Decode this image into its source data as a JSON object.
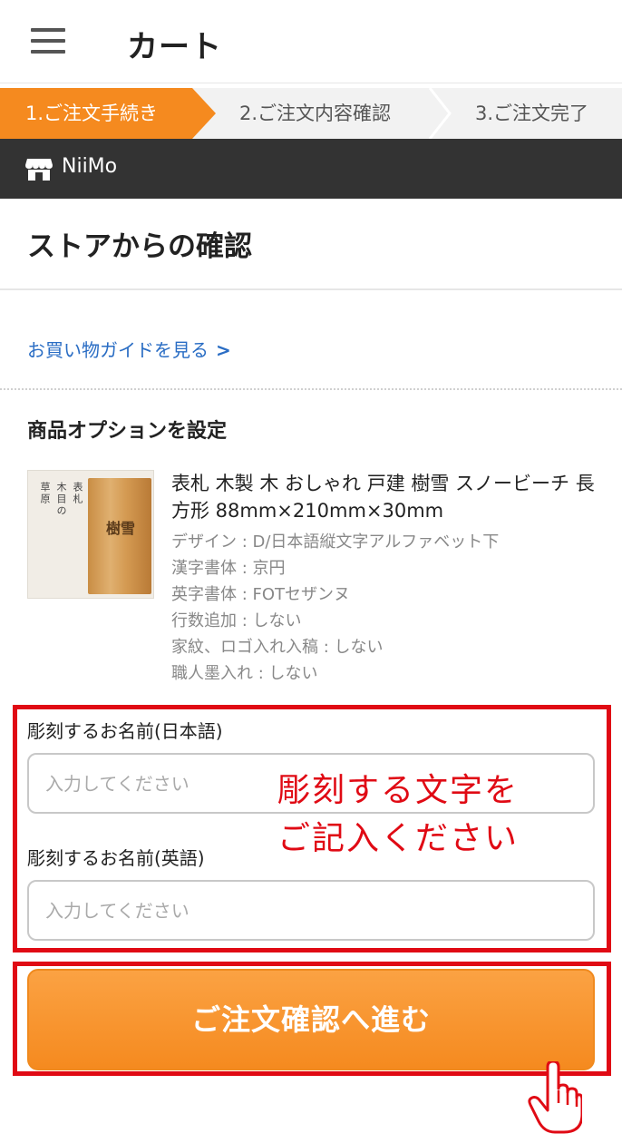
{
  "header": {
    "title": "カート"
  },
  "steps": [
    {
      "label": "1.ご注文手続き",
      "active": true
    },
    {
      "label": "2.ご注文内容確認",
      "active": false
    },
    {
      "label": "3.ご注文完了",
      "active": false
    }
  ],
  "store": {
    "name": "NiiMo",
    "icon": "store-icon"
  },
  "section": {
    "title": "ストアからの確認"
  },
  "guide": {
    "label": "お買い物ガイドを見る",
    "arrow": ">"
  },
  "options": {
    "title": "商品オプションを設定"
  },
  "product": {
    "name": "表札 木製 木 おしゃれ 戸建 樹雪 スノービーチ 長方形 88mm×210mm×30mm",
    "attributes": [
      "デザイン : D/日本語縦文字アルファベット下",
      "漢字書体 : 京円",
      "英字書体 : FOTセザンヌ",
      "行数追加 : しない",
      "家紋、ロゴ入れ入稿 : しない",
      "職人墨入れ : しない"
    ],
    "thumbnail": {
      "plank_text": "樹雪",
      "v1": "草原",
      "v2": "木目の",
      "v3": "表札"
    }
  },
  "form": {
    "name_jp": {
      "label": "彫刻するお名前(日本語)",
      "placeholder": "入力してください",
      "value": ""
    },
    "name_en": {
      "label": "彫刻するお名前(英語)",
      "placeholder": "入力してください",
      "value": ""
    }
  },
  "annotation": {
    "line1": "彫刻する文字を",
    "line2": "ご記入ください"
  },
  "cta": {
    "label": "ご注文確認へ進む"
  },
  "colors": {
    "accent": "#f58a1f",
    "annotation_red": "#e00a14",
    "link": "#2a6dc4",
    "store_bar": "#333333"
  }
}
